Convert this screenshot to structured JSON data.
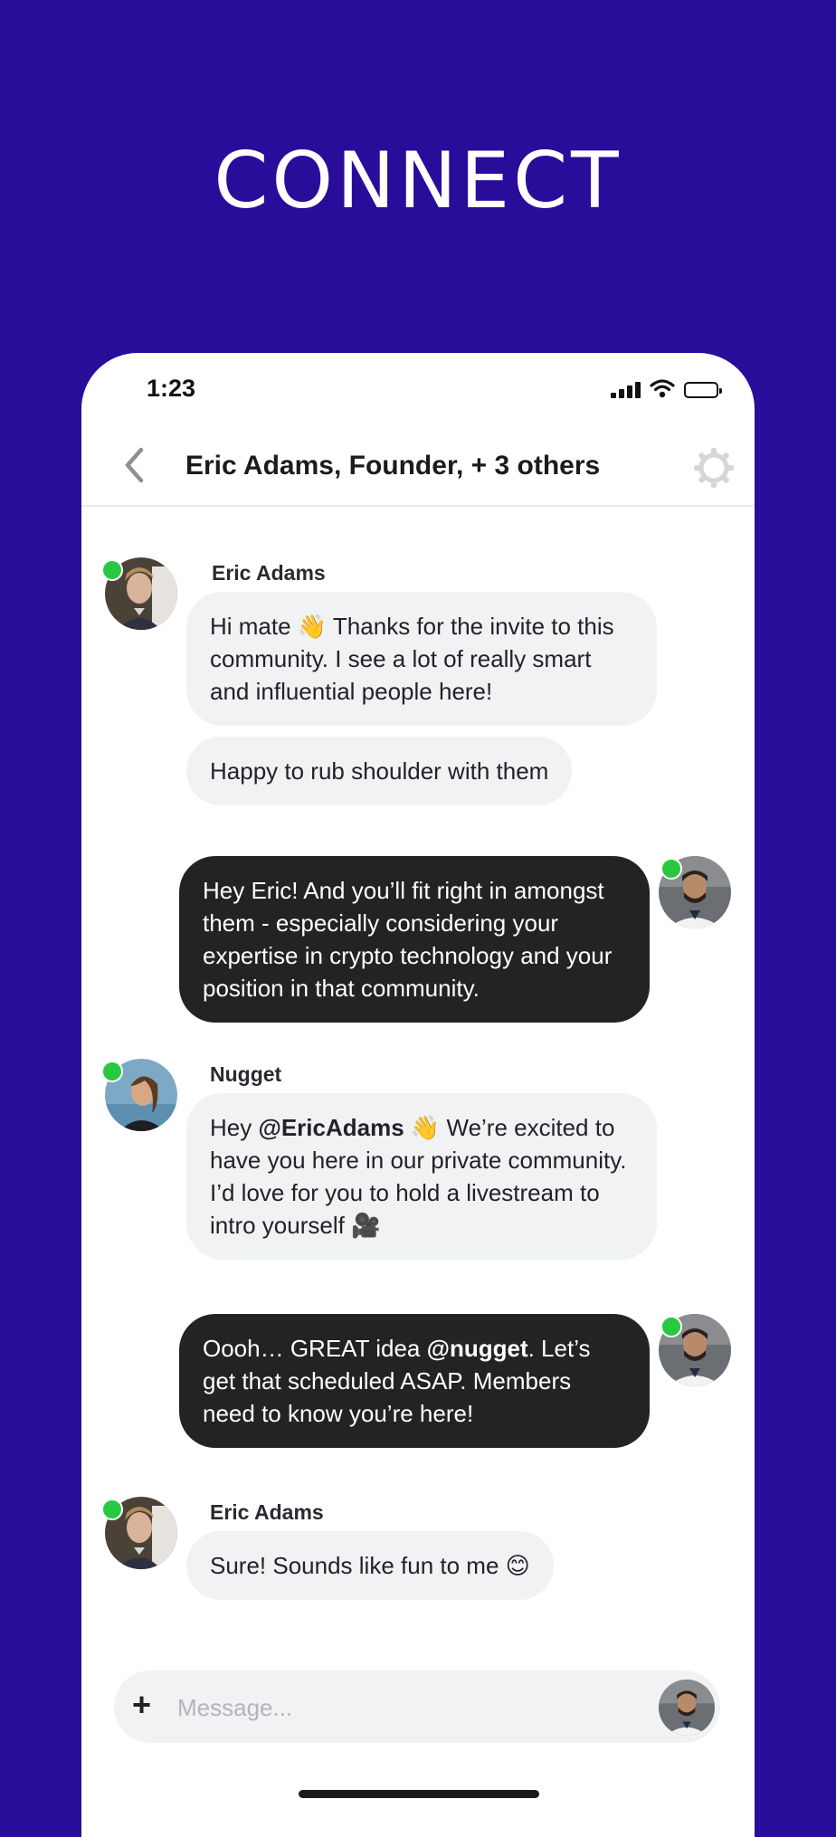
{
  "hero": {
    "title": "CONNECT"
  },
  "status_bar": {
    "time": "1:23"
  },
  "nav": {
    "title": "Eric Adams, Founder, + 3 others"
  },
  "messages": [
    {
      "sender": "Eric Adams",
      "texts": [
        "Hi mate 👋 Thanks for the invite to this community. I see a lot of really smart and influential people here!",
        "Happy to rub shoulder with them"
      ]
    },
    {
      "text": "Hey Eric! And you’ll fit right in amongst them - especially considering your expertise in crypto technology and your position in that community."
    },
    {
      "sender": "Nugget",
      "prefix": "Hey ",
      "mention": "@EricAdams",
      "suffix": " 👋 We’re excited to have you here in our private community. I’d love for you to hold a livestream to intro yourself 🎥"
    },
    {
      "prefix": "Oooh… GREAT idea ",
      "mention": "@nugget",
      "suffix": ". Let’s get that scheduled ASAP. Members need to know you’re here!"
    },
    {
      "sender": "Eric Adams",
      "text": "Sure! Sounds like fun to me 😊"
    }
  ],
  "composer": {
    "placeholder": "Message..."
  },
  "colors": {
    "background": "#2a0c9a",
    "outgoing_bubble": "#232325",
    "incoming_bubble": "#f1f2f4",
    "online": "#28c840"
  }
}
